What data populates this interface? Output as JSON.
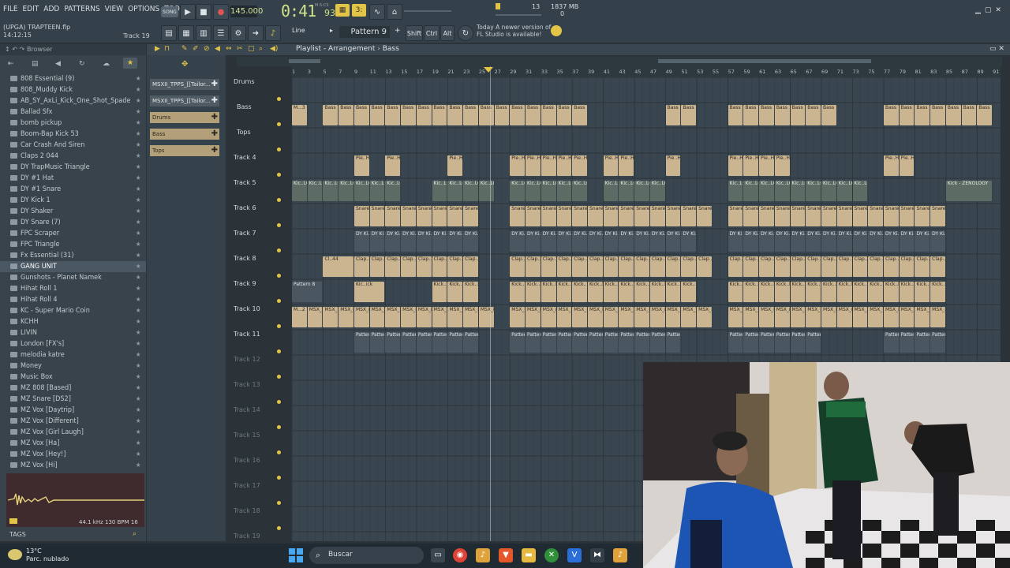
{
  "menubar": {
    "items": [
      "FILE",
      "EDIT",
      "ADD",
      "PATTERNS",
      "VIEW",
      "OPTIONS",
      "TOOLS",
      "HELP"
    ],
    "song_toggle": "SONG",
    "tempo": "145.000",
    "time_main": "0:41",
    "time_sub": "93",
    "time_caption": "M:S:CS",
    "cpu_value": "13",
    "memory": "1837 MB",
    "memory_sub": "0"
  },
  "toolbar2": {
    "project_line1": "(UPGA) TRAPTEEN.flp",
    "project_line2": "14:12:15",
    "track_hint": "Track 19",
    "snap": "Line",
    "pattern": "Pattern 9",
    "shift": "Shift",
    "ctrl": "Ctrl",
    "alt": "Alt",
    "news_line1": "Today   A newer version of",
    "news_line2": "FL Studio is available!"
  },
  "browser": {
    "title": "Browser",
    "items": [
      "808 Essential (9)",
      "808_Muddy Kick",
      "AB_SY_AxLi_Kick_One_Shot_Spade",
      "Ballad Sfx",
      "bomb pickup",
      "Boom-Bap Kick 53",
      "Car Crash And Siren",
      "Claps 2 044",
      "DY  TrapMusic Triangle",
      "DY #1 Hat",
      "DY #1 Snare",
      "DY Kick 1",
      "DY Shaker",
      "DY Snare (7)",
      "FPC Scraper",
      "FPC Triangle",
      "Fx Essential (31)",
      "GANG UNIT",
      "Gunshots - Planet Namek",
      "Hihat Roll 1",
      "Hihat Roll 4",
      "KC - Super Mario Coin",
      "KCHH",
      "LIVIN",
      "London [FX's]",
      "melodia katre",
      "Money",
      "Music Box",
      "MZ 808 [Based]",
      "MZ Snare [DS2]",
      "MZ Vox [Daytrip]",
      "MZ Vox [Different]",
      "MZ Vox [Girl Laugh]",
      "MZ Vox [Ha]",
      "MZ Vox [Hey!]",
      "MZ Vox [Hi]"
    ],
    "selected_index": 17,
    "sample_info": "44.1 kHz 130 BPM 16",
    "tags": "TAGS"
  },
  "picker": {
    "items": [
      "MSXII_TPPS_[[Tailor...",
      "MSXII_TPPS_[[Tailor...",
      "Drums",
      "Bass",
      "Tops"
    ]
  },
  "playlist": {
    "title": "Playlist - Arrangement",
    "breadcrumb": "Bass",
    "ruler_ticks": [
      "1",
      "3",
      "5",
      "7",
      "9",
      "11",
      "13",
      "15",
      "17",
      "19",
      "21",
      "23",
      "25",
      "27",
      "29",
      "31",
      "33",
      "35",
      "37",
      "39",
      "41",
      "43",
      "45",
      "47",
      "49",
      "51",
      "53",
      "55",
      "57",
      "59",
      "61",
      "63",
      "65",
      "67",
      "69",
      "71",
      "73",
      "75",
      "77",
      "79",
      "81",
      "83",
      "85",
      "87",
      "89",
      "91"
    ],
    "group_labels": [
      "Drums",
      "Bass",
      "Tops"
    ],
    "tracks": [
      "Track 4",
      "Track 5",
      "Track 6",
      "Track 7",
      "Track 8",
      "Track 9",
      "Track 10",
      "Track 11",
      "Track 12",
      "Track 13",
      "Track 14",
      "Track 15",
      "Track 16",
      "Track 17",
      "Track 18",
      "Track 19"
    ],
    "clip_labels": {
      "bass": "Bass",
      "bass_first": "M...3",
      "hat": "Pie..Hat",
      "kick": "Kic..LOGY",
      "kick_last": "Kick - ZENOLOGY",
      "snare": "Snare",
      "dy": "DY Ki..#2",
      "clap": "Clap..044",
      "clap_first": "Cl..44",
      "kk": "Kick..Kick",
      "kk_first": "Kic..ick",
      "pattern8": "Pattern 8",
      "msx": "MSX_rt_2",
      "msx_first": "M...2",
      "pattern9": "Pattern 9"
    }
  },
  "taskbar": {
    "temp": "13°C",
    "weather": "Parc. nublado",
    "search": "Buscar"
  }
}
